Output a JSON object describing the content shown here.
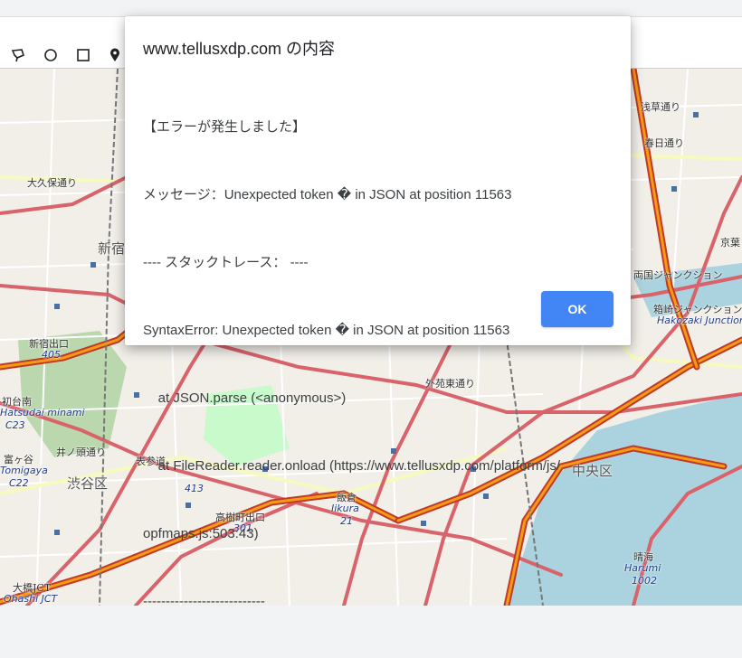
{
  "dialog": {
    "title": "www.tellusxdp.com の内容",
    "lines": [
      "【エラーが発生しました】",
      "メッセージ：Unexpected token � in JSON at position 11563",
      "---- スタックトレース： ----",
      "SyntaxError: Unexpected token � in JSON at position 11563",
      "    at JSON.parse (<anonymous>)",
      "    at FileReader.reader.onload (https://www.tellusxdp.com/platform/js/",
      "opfmaps.js:503:43)",
      "---------------------------"
    ],
    "ok_label": "OK",
    "ok_color": "#4285f4"
  },
  "toolbar": {
    "tools": [
      {
        "icon": "lasso-icon"
      },
      {
        "icon": "circle-icon"
      },
      {
        "icon": "square-icon"
      },
      {
        "icon": "map-pin-icon"
      }
    ]
  },
  "map": {
    "labels": [
      {
        "text": "大久保通り",
        "class": ""
      },
      {
        "text": "新宿",
        "class": "big"
      },
      {
        "text": "新宿出口",
        "class": ""
      },
      {
        "text": "405",
        "class": "blue"
      },
      {
        "text": "初台南",
        "class": ""
      },
      {
        "text": "Hatsudai minami",
        "class": "blue"
      },
      {
        "text": "C23",
        "class": "blue"
      },
      {
        "text": "井ノ頭通り",
        "class": ""
      },
      {
        "text": "富ヶ谷",
        "class": ""
      },
      {
        "text": "Tomigaya",
        "class": "blue"
      },
      {
        "text": "C22",
        "class": "blue"
      },
      {
        "text": "渋谷区",
        "class": "big"
      },
      {
        "text": "表参道",
        "class": ""
      },
      {
        "text": "413",
        "class": "blue"
      },
      {
        "text": "高樹町出口",
        "class": ""
      },
      {
        "text": "301",
        "class": "blue"
      },
      {
        "text": "飯倉",
        "class": ""
      },
      {
        "text": "Iikura",
        "class": "blue"
      },
      {
        "text": "21",
        "class": "blue"
      },
      {
        "text": "大橋JCT",
        "class": ""
      },
      {
        "text": "Ohashi JCT",
        "class": "blue"
      },
      {
        "text": "外苑東通り",
        "class": ""
      },
      {
        "text": "浅草通り",
        "class": ""
      },
      {
        "text": "春日通り",
        "class": ""
      },
      {
        "text": "京葉",
        "class": ""
      },
      {
        "text": "両国ジャンクション",
        "class": ""
      },
      {
        "text": "箱崎ジャンクション",
        "class": ""
      },
      {
        "text": "Hakozaki Junction",
        "class": "blue"
      },
      {
        "text": "中央区",
        "class": "big"
      },
      {
        "text": "晴海",
        "class": ""
      },
      {
        "text": "Harumi",
        "class": "blue"
      },
      {
        "text": "1002",
        "class": "blue"
      }
    ],
    "colors": {
      "background": "#f2efe9",
      "motorway": "#e892a2",
      "trunk": "#f9b29c",
      "primary": "#fcd6a4",
      "secondary": "#f7fabf",
      "park": "#c8facc",
      "forest": "#add19e",
      "water": "#aad3df",
      "highway_core": "#f39c12"
    }
  }
}
